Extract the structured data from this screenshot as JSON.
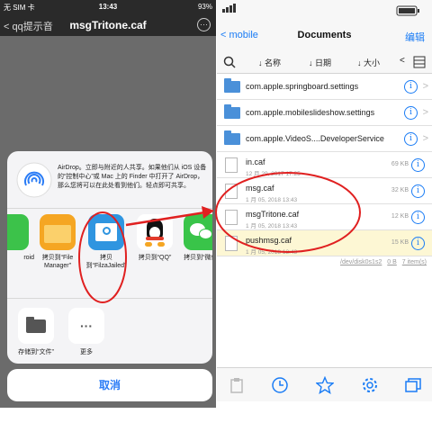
{
  "left": {
    "status": {
      "carrier": "无 SIM 卡",
      "time": "13:43",
      "battery": "93%"
    },
    "nav": {
      "back_label": "qq提示音",
      "title": "msgTritone.caf",
      "more_label": "···"
    },
    "airdrop_text": "AirDrop。立即与附近的人共享。如果他们从 iOS 设备的“控制中心”或 Mac 上的 Finder 中打开了 AirDrop，那么您将可以在此处看到他们。轻点即可共享。",
    "apps": [
      {
        "label": "roid",
        "color": "#3cc24a"
      },
      {
        "label": "拷贝到“File Manager”",
        "color": "#f5a623"
      },
      {
        "label": "拷贝 到“FilzaJailed”",
        "color": "#2f95e0"
      },
      {
        "label": "拷贝到“QQ”",
        "color": "#ffffff"
      },
      {
        "label": "拷贝到“微信”",
        "color": "#39c449"
      }
    ],
    "actions": [
      {
        "label": "存储到“文件”",
        "icon": "folder-icon"
      },
      {
        "label": "更多",
        "icon": "more-icon"
      }
    ],
    "cancel_label": "取消"
  },
  "right": {
    "nav": {
      "back_label": "mobile",
      "title": "Documents",
      "edit_label": "编辑"
    },
    "sort": {
      "name": "名称",
      "date": "日期",
      "size": "大小"
    },
    "rows": [
      {
        "type": "folder",
        "name": "com.apple.springboard.settings"
      },
      {
        "type": "folder",
        "name": "com.apple.mobileslideshow.settings"
      },
      {
        "type": "folder",
        "name": "com.apple.VideoS....DeveloperService"
      },
      {
        "type": "file",
        "name": "in.caf",
        "date": "12 月 29, 2017 17:25",
        "size": "69 KB"
      },
      {
        "type": "file",
        "name": "msg.caf",
        "date": "1 月 05, 2018 13:43",
        "size": "32 KB"
      },
      {
        "type": "file",
        "name": "msgTritone.caf",
        "date": "1 月 05, 2018 13:43",
        "size": "12 KB"
      },
      {
        "type": "file",
        "name": "pushmsg.caf",
        "date": "1 月 05, 2018 13:43",
        "size": "15 KB",
        "highlight": true
      }
    ],
    "footer": {
      "path": "/dev/disk0s1s2",
      "size": "0 B",
      "items": "7 item(s)"
    }
  },
  "colors": {
    "accent": "#1a7cf5",
    "annotation": "#e02020",
    "highlight_row": "#fdf7d4"
  }
}
